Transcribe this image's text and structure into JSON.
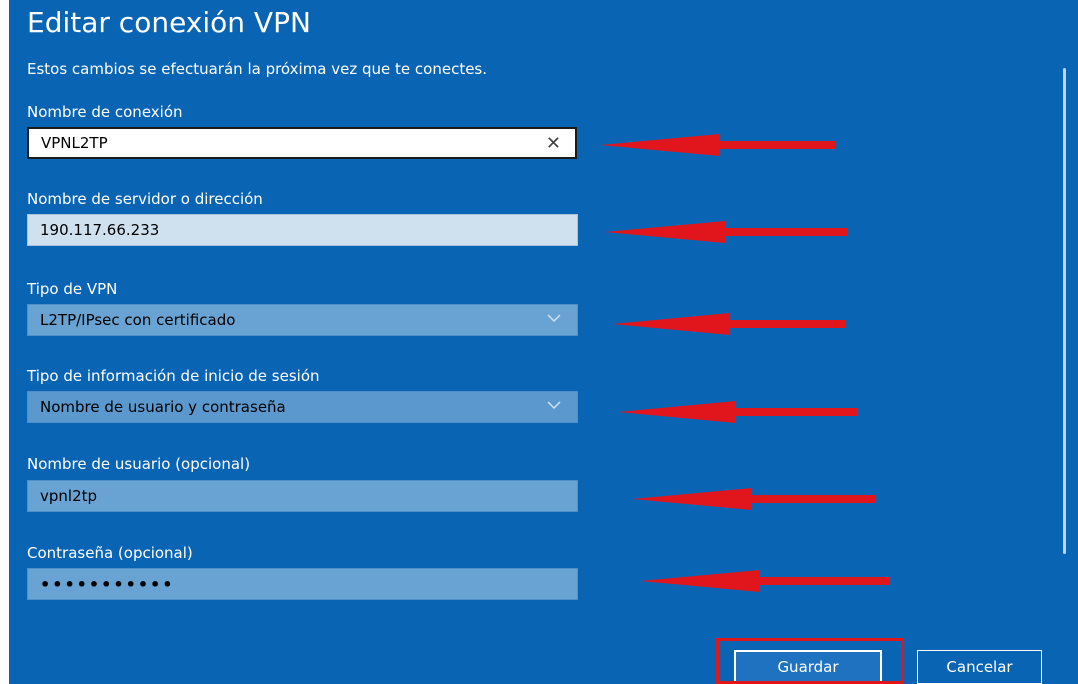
{
  "dialog": {
    "title": "Editar conexión VPN",
    "subtitle": "Estos cambios se efectuarán la próxima vez que te conectes."
  },
  "fields": {
    "connection_name": {
      "label": "Nombre de conexión",
      "value": "VPNL2TP"
    },
    "server": {
      "label": "Nombre de servidor o dirección",
      "value": "190.117.66.233"
    },
    "vpn_type": {
      "label": "Tipo de VPN",
      "value": "L2TP/IPsec con certificado"
    },
    "signin_type": {
      "label": "Tipo de información de inicio de sesión",
      "value": "Nombre de usuario y contraseña"
    },
    "username": {
      "label": "Nombre de usuario (opcional)",
      "value": "vpnl2tp"
    },
    "password": {
      "label": "Contraseña (opcional)",
      "value": "•••••••••••"
    }
  },
  "icons": {
    "clear": "close-icon",
    "dropdown": "chevron-down-icon"
  },
  "buttons": {
    "save": "Guardar",
    "cancel": "Cancelar"
  },
  "colors": {
    "panel_bg": "#0a64b4",
    "annotation": "#e0161c"
  }
}
